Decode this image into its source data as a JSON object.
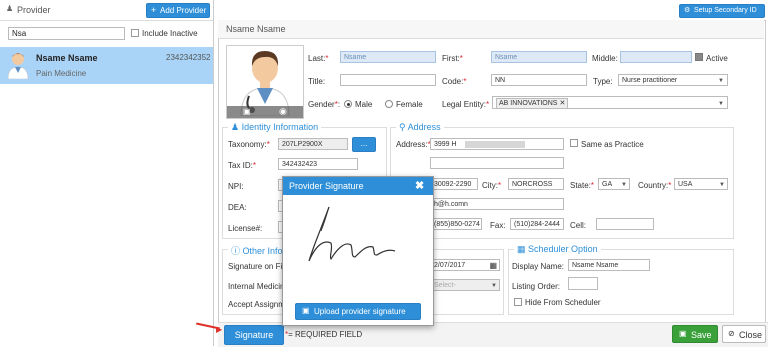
{
  "left": {
    "title": "Provider",
    "add_button": "Add Provider",
    "search_value": "Nsa",
    "include_inactive": "Include Inactive",
    "providers": [
      {
        "name": "Nsame Nsame",
        "id": "2342342352",
        "specialty": "Pain Medicine"
      }
    ]
  },
  "header": {
    "setup_secondary_id": "Setup Secondary ID",
    "provider_name": "Nsame Nsame"
  },
  "basic": {
    "last_label": "Last:",
    "last_value": "Nsame",
    "first_label": "First:",
    "first_value": "Nsame",
    "middle_label": "Middle:",
    "active_label": "Active",
    "title_label": "Title:",
    "code_label": "Code:",
    "code_value": "NN",
    "type_label": "Type:",
    "type_value": "Nurse practitioner",
    "gender_label": "Gender",
    "male_label": "Male",
    "female_label": "Female",
    "legal_entity_label": "Legal Entity:",
    "legal_entity_value": "AB INNOVATIONS"
  },
  "identity": {
    "section_title": "Identity Information",
    "taxonomy_label": "Taxonomy:",
    "taxonomy_value": "207LP2900X",
    "taxonomy_button": "...",
    "tax_id_label": "Tax ID:",
    "tax_id_value": "342432423",
    "npi_label": "NPI:",
    "dea_label": "DEA:",
    "license_label": "License#:"
  },
  "address": {
    "section_title": "Address",
    "address_label": "Address:",
    "address_value": "3999 H",
    "same_as_practice": "Same as Practice",
    "zip_value": "30092-2290",
    "city_label": "City:",
    "city_value": "NORCROSS",
    "state_label": "State:",
    "state_value": "GA",
    "country_label": "Country:",
    "country_value": "USA",
    "email_value": "h@h.comn",
    "phone_value": "(855)850-0274",
    "fax_label": "Fax:",
    "fax_value": "(510)284-2444",
    "cell_label": "Cell:"
  },
  "other": {
    "section_title": "Other Info",
    "signature_on_file": "Signature on Fi",
    "internal_medicine": "Internal Medicin",
    "accept_assignment": "Accept Assignm",
    "date_value": "2/07/2017",
    "select_placeholder": "Select-"
  },
  "scheduler": {
    "section_title": "Scheduler Option",
    "display_name_label": "Display Name:",
    "display_name_value": "Nsame Nsame",
    "listing_order_label": "Listing Order:",
    "hide_label": "Hide From Scheduler"
  },
  "popup": {
    "title": "Provider Signature",
    "upload_button": "Upload provider signature"
  },
  "footer": {
    "signature_button": "Signature",
    "required_note": "= REQUIRED FIELD",
    "save_button": "Save",
    "close_button": "Close"
  },
  "colors": {
    "accent": "#2e8fd8",
    "required": "#d9272e",
    "save": "#3aa03a"
  }
}
